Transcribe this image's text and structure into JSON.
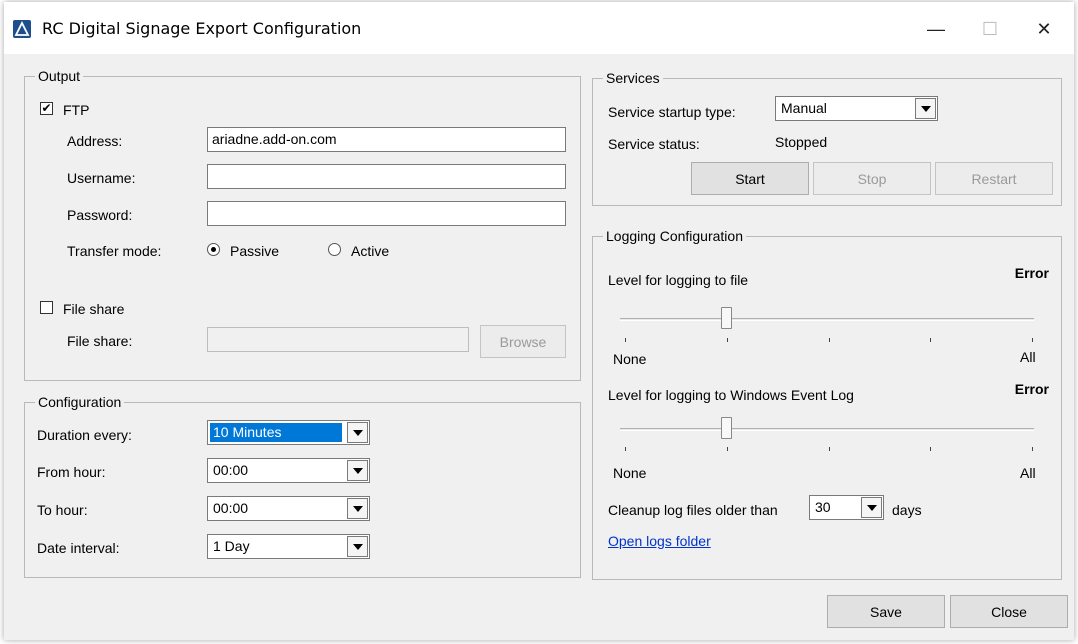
{
  "window": {
    "title": "RC Digital Signage Export Configuration",
    "controls": {
      "minimize": "—",
      "maximize": "☐",
      "close": "✕"
    }
  },
  "output": {
    "title": "Output",
    "ftp": {
      "label": "FTP",
      "checked": "✔",
      "address_label": "Address:",
      "address_value": "ariadne.add-on.com",
      "username_label": "Username:",
      "username_value": "",
      "password_label": "Password:",
      "password_value": "",
      "transfer_label": "Transfer mode:",
      "passive_label": "Passive",
      "active_label": "Active",
      "selected_mode": "Passive"
    },
    "fileshare": {
      "label": "File share",
      "checked": "",
      "path_label": "File share:",
      "path_value": "",
      "browse_label": "Browse"
    }
  },
  "configuration": {
    "title": "Configuration",
    "duration_label": "Duration every:",
    "duration_value": "10 Minutes",
    "from_label": "From hour:",
    "from_value": "00:00",
    "to_label": "To hour:",
    "to_value": "00:00",
    "interval_label": "Date interval:",
    "interval_value": "1 Day"
  },
  "services": {
    "title": "Services",
    "startup_label": "Service startup type:",
    "startup_value": "Manual",
    "status_label": "Service status:",
    "status_value": "Stopped",
    "start_label": "Start",
    "stop_label": "Stop",
    "restart_label": "Restart"
  },
  "logging": {
    "title": "Logging Configuration",
    "file_label": "Level for logging to file",
    "file_level": "Error",
    "event_label": "Level for logging to Windows Event Log",
    "event_level": "Error",
    "slider_min": "None",
    "slider_max": "All",
    "levels_count": 5,
    "file_level_index": 1,
    "event_level_index": 1,
    "cleanup_label": "Cleanup log files older than",
    "cleanup_value": "30",
    "cleanup_unit": "days",
    "open_folder_link": "Open logs folder"
  },
  "footer": {
    "save_label": "Save",
    "close_label": "Close"
  },
  "colors": {
    "accent": "#0078d7",
    "link": "#0033cc",
    "window_bg": "#f0f0f0"
  }
}
